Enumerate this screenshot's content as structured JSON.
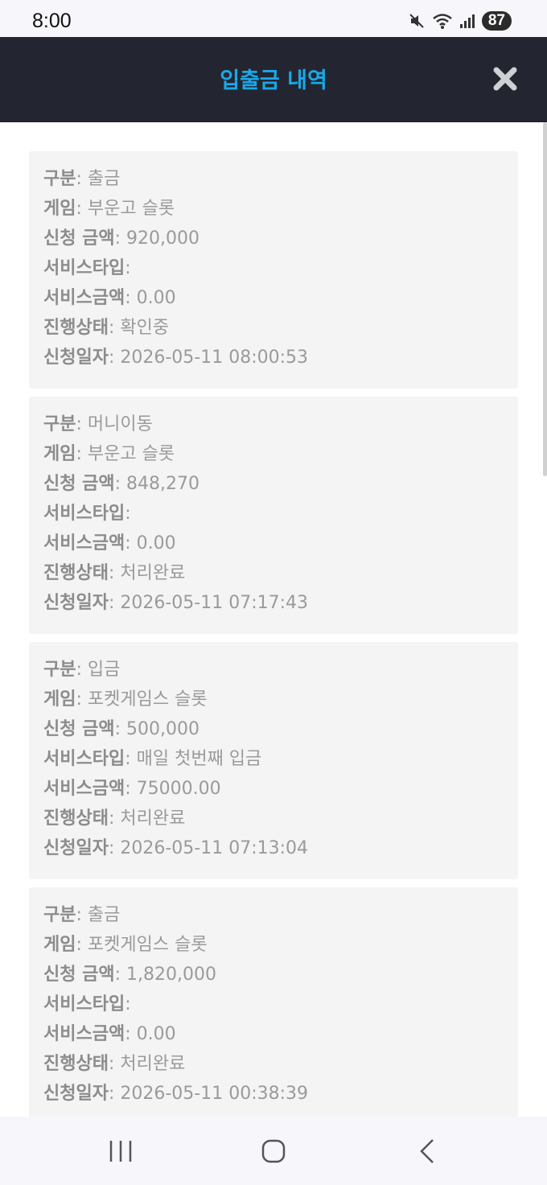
{
  "status": {
    "time": "8:00",
    "battery": "87"
  },
  "header": {
    "title": "입출금 내역"
  },
  "labels": {
    "type": "구분",
    "game": "게임",
    "amount": "신청 금액",
    "service_type": "서비스타입",
    "service_amount": "서비스금액",
    "state": "진행상태",
    "date": "신청일자"
  },
  "records": [
    {
      "type": "출금",
      "game": "부운고 슬롯",
      "amount": "920,000",
      "service_type": "",
      "service_amount": "0.00",
      "state": "확인중",
      "date": "2026-05-11 08:00:53"
    },
    {
      "type": "머니이동",
      "game": "부운고 슬롯",
      "amount": "848,270",
      "service_type": "",
      "service_amount": "0.00",
      "state": "처리완료",
      "date": "2026-05-11 07:17:43"
    },
    {
      "type": "입금",
      "game": "포켓게임스 슬롯",
      "amount": "500,000",
      "service_type": "매일 첫번째 입금",
      "service_amount": "75000.00",
      "state": "처리완료",
      "date": "2026-05-11 07:13:04"
    },
    {
      "type": "출금",
      "game": "포켓게임스 슬롯",
      "amount": "1,820,000",
      "service_type": "",
      "service_amount": "0.00",
      "state": "처리완료",
      "date": "2026-05-11 00:38:39"
    }
  ],
  "icons": {
    "close": "close-icon",
    "recents": "recents-icon",
    "home": "home-icon",
    "back": "back-icon"
  }
}
